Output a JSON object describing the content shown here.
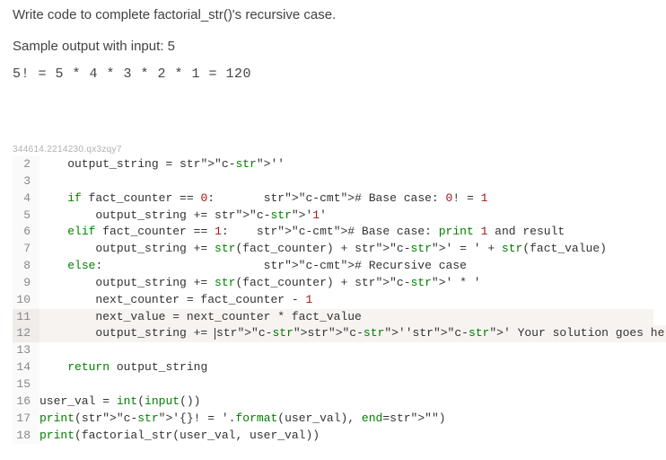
{
  "instruction": "Write code to complete factorial_str()'s recursive case.",
  "sample_label": "Sample output with input: 5",
  "sample_output": "5! = 5 * 4 * 3 * 2 * 1 = 120",
  "watermark": "344614.2214230.qx3zqy7",
  "code": {
    "lines": [
      {
        "n": 2,
        "hl": false,
        "text": "    output_string = ''"
      },
      {
        "n": 3,
        "hl": false,
        "text": ""
      },
      {
        "n": 4,
        "hl": false,
        "text": "    if fact_counter == 0:       # Base case: 0! = 1"
      },
      {
        "n": 5,
        "hl": false,
        "text": "        output_string += '1'"
      },
      {
        "n": 6,
        "hl": false,
        "text": "    elif fact_counter == 1:    # Base case: print 1 and result"
      },
      {
        "n": 7,
        "hl": false,
        "text": "        output_string += str(fact_counter) + ' = ' + str(fact_value)"
      },
      {
        "n": 8,
        "hl": false,
        "text": "    else:                       # Recursive case"
      },
      {
        "n": 9,
        "hl": false,
        "text": "        output_string += str(fact_counter) + ' * '"
      },
      {
        "n": 10,
        "hl": false,
        "text": "        next_counter = fact_counter - 1"
      },
      {
        "n": 11,
        "hl": true,
        "text": "        next_value = next_counter * fact_value"
      },
      {
        "n": 12,
        "hl": true,
        "text": "        output_string += |''' Your solution goes here '''"
      },
      {
        "n": 13,
        "hl": false,
        "text": ""
      },
      {
        "n": 14,
        "hl": false,
        "text": "    return output_string"
      },
      {
        "n": 15,
        "hl": false,
        "text": ""
      },
      {
        "n": 16,
        "hl": false,
        "text": "user_val = int(input())"
      },
      {
        "n": 17,
        "hl": false,
        "text": "print('{}! = '.format(user_val), end=\"\")"
      },
      {
        "n": 18,
        "hl": false,
        "text": "print(factorial_str(user_val, user_val))"
      }
    ]
  }
}
